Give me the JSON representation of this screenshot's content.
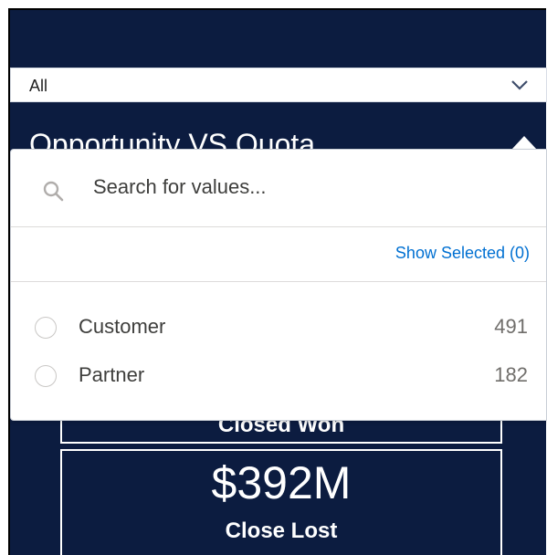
{
  "filter": {
    "selected_value": "All",
    "chevron_icon": "chevron-down-icon"
  },
  "panel": {
    "title": "Opportunity VS Quota"
  },
  "metrics": {
    "won_label": "Closed Won",
    "lost_value": "$392M",
    "lost_label": "Close Lost"
  },
  "dropdown": {
    "search_icon": "search-icon",
    "search_placeholder": "Search for values...",
    "show_selected": "Show Selected (0)",
    "options": [
      {
        "label": "Customer",
        "count": "491",
        "selected": false
      },
      {
        "label": "Partner",
        "count": "182",
        "selected": false
      }
    ]
  },
  "colors": {
    "background": "#0c1c40",
    "link": "#0070d2",
    "text": "#3e3e3c"
  }
}
